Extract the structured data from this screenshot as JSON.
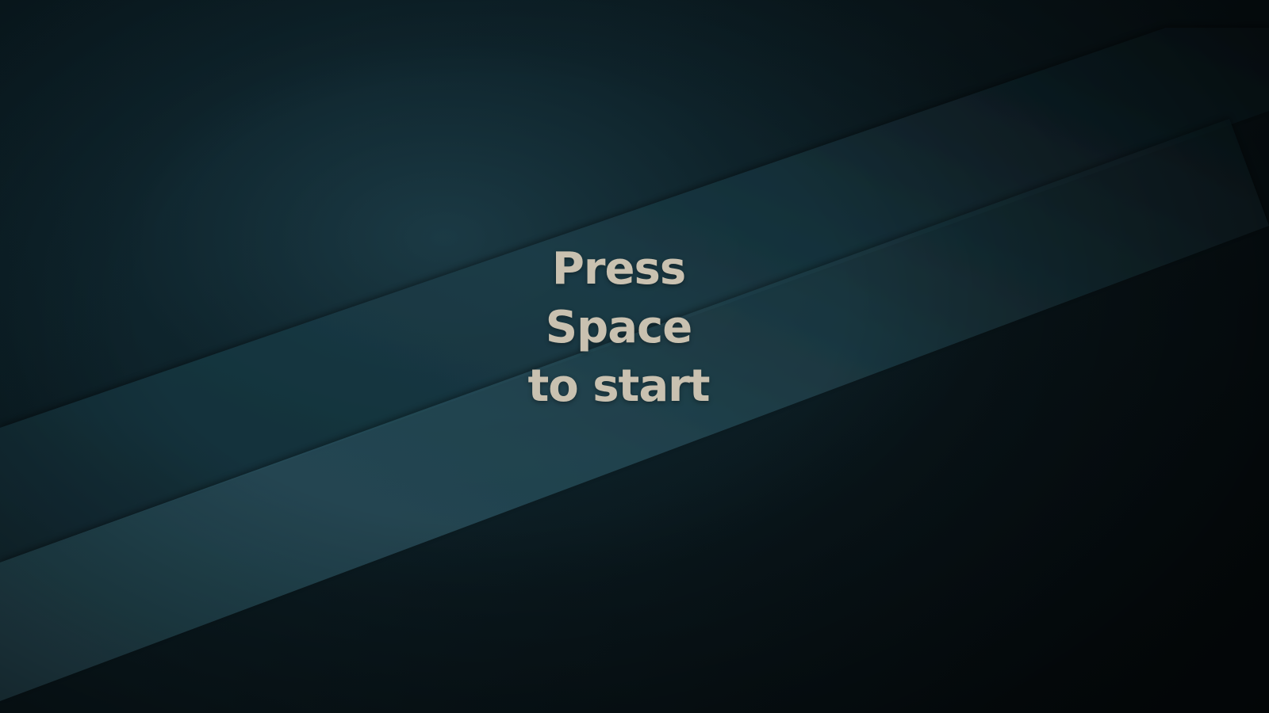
{
  "game": {
    "title_screen": {
      "prompt_lines": [
        "Press",
        "Space",
        "to start"
      ]
    }
  },
  "colors": {
    "background_dark": "#081418",
    "band_light": "#2f5865",
    "band_mid": "#1c3c47",
    "prompt_text": "#c9c1b0"
  }
}
